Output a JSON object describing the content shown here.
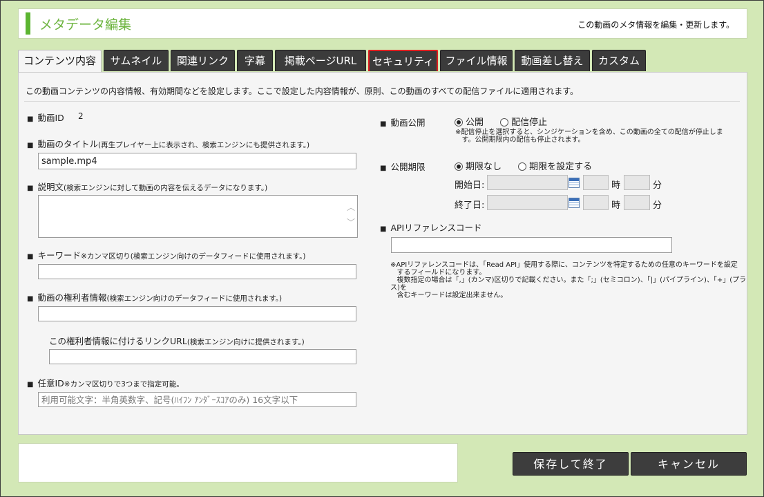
{
  "header": {
    "title": "メタデータ編集",
    "description": "この動画のメタ情報を編集・更新します。"
  },
  "tabs": [
    {
      "label": "コンテンツ内容"
    },
    {
      "label": "サムネイル"
    },
    {
      "label": "関連リンク"
    },
    {
      "label": "字幕"
    },
    {
      "label": "掲載ページURL"
    },
    {
      "label": "セキュリティ"
    },
    {
      "label": "ファイル情報"
    },
    {
      "label": "動画差し替え"
    },
    {
      "label": "カスタム"
    }
  ],
  "intro": "この動画コンテンツの内容情報、有効期間などを設定します。ここで設定した内容情報が、原則、この動画のすべての配信ファイルに適用されます。",
  "left": {
    "video_id_label": "動画ID",
    "video_id_value": "2",
    "title_label": "動画のタイトル",
    "title_note": "(再生プレイヤー上に表示され、検索エンジンにも提供されます。)",
    "title_value": "sample.mp4",
    "desc_label": "説明文",
    "desc_note": "(検索エンジンに対して動画の内容を伝えるデータになります。)",
    "keyword_label": "キーワード",
    "keyword_note": "※カンマ区切り(検索エンジン向けのデータフィードに使用されます。)",
    "rights_label": "動画の権利者情報",
    "rights_note": "(検索エンジン向けのデータフィードに使用されます。)",
    "rights_link_label": "この権利者情報に付けるリンクURL",
    "rights_link_note": "(検索エンジン向けに提供されます。)",
    "optional_id_label": "任意ID",
    "optional_id_note": "※カンマ区切りで3つまで指定可能。",
    "optional_id_placeholder": "利用可能文字：半角英数字、記号(ﾊｲﾌﾝ ｱﾝﾀﾞｰｽｺｱのみ) 16文字以下"
  },
  "right": {
    "publish_label": "動画公開",
    "publish_option_on": "公開",
    "publish_option_off": "配信停止",
    "publish_note_1": "※配信停止を選択すると、シンジケーションを含め、この動画の全ての配信が停止しま",
    "publish_note_2": "す。公開期限内の配信も停止されます。",
    "period_label": "公開期限",
    "period_option_none": "期限なし",
    "period_option_set": "期限を設定する",
    "start_label": "開始日:",
    "end_label": "終了日:",
    "hour_label": "時",
    "minute_label": "分",
    "api_label": "APIリファレンスコード",
    "api_note_1": "※APIリファレンスコードは、「Read API」使用する際に、コンテンツを特定するための任意のキーワードを設定",
    "api_note_2": "するフィールドになります。",
    "api_note_3": "複数指定の場合は「,」(カンマ)区切りで記載ください。また「;」(セミコロン)、「|」(パイプライン)、「+」(プラス)を",
    "api_note_4": "含むキーワードは設定出来ません。"
  },
  "buttons": {
    "save": "保存して終了",
    "cancel": "キャンセル"
  }
}
